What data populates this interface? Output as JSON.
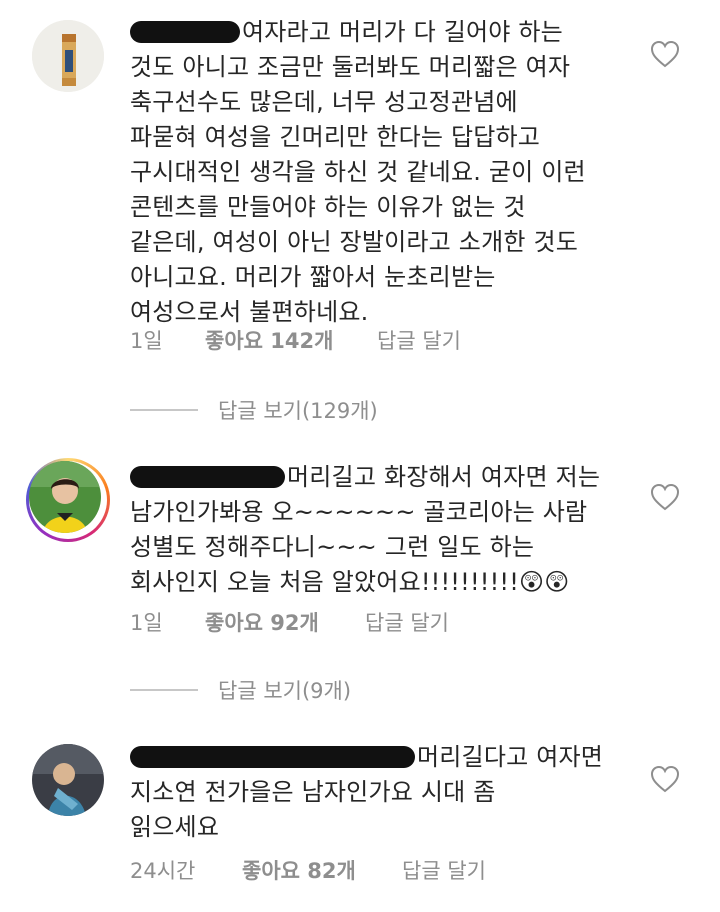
{
  "comments": [
    {
      "text": "여자라고 머리가 다 길어야 하는\n것도 아니고 조금만 둘러봐도 머리짧은 여자\n축구선수도 많은데, 너무 성고정관념에\n파묻혀 여성을 긴머리만 한다는 답답하고\n구시대적인 생각을 하신 것 같네요. 굳이 이런\n콘텐츠를 만들어야 하는 이유가 없는 것\n같은데, 여성이 아닌 장발이라고 소개한 것도\n아니고요. 머리가 짧아서 눈초리받는\n여성으로서 불편하네요.",
      "time": "1일",
      "likes": "좋아요 142개",
      "reply": "답글 달기",
      "view_replies": "답글 보기(129개)"
    },
    {
      "text": "머리길고 화장해서 여자면 저는\n남가인가봐용 오~~~~~~ 골코리아는 사람\n성별도 정해주다니~~~ 그런 일도 하는\n회사인지 오늘 처음 알았어요!!!!!!!!!!😲😲",
      "time": "1일",
      "likes": "좋아요 92개",
      "reply": "답글 달기",
      "view_replies": "답글 보기(9개)"
    },
    {
      "text": "머리길다고 여자면\n지소연 전가을은 남자인가요 시대 좀\n읽으세요",
      "time": "24시간",
      "likes": "좋아요 82개",
      "reply": "답글 달기"
    }
  ],
  "icons": {
    "like": "heart-outline-icon"
  },
  "colors": {
    "text": "#262626",
    "meta": "#8e8e8e",
    "divider": "#c7c7c7"
  }
}
